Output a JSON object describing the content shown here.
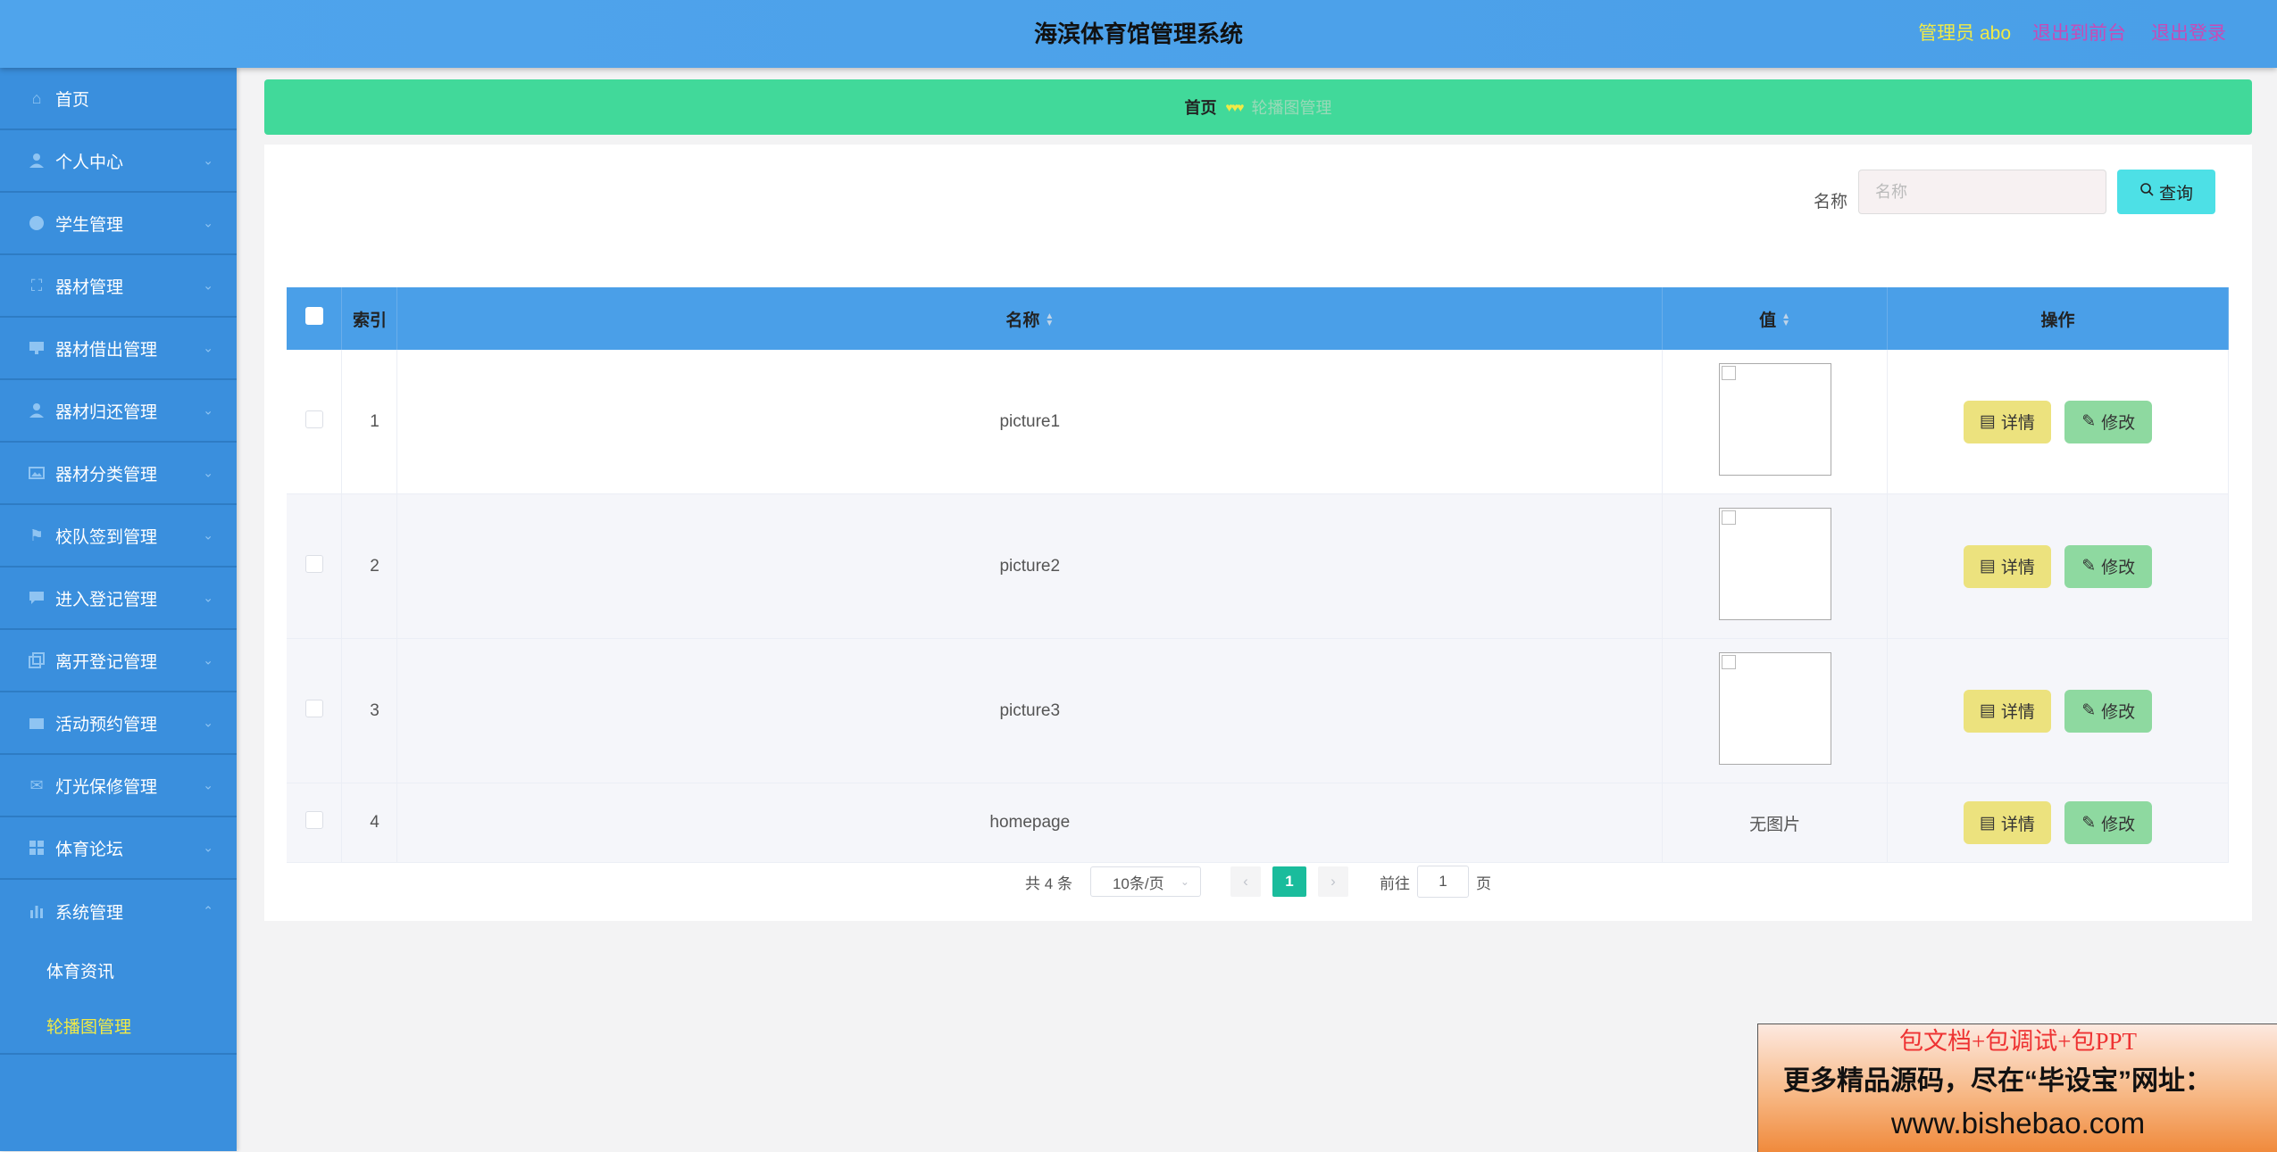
{
  "header": {
    "title": "海滨体育馆管理系统",
    "admin": "管理员 abo",
    "front": "退出到前台",
    "logout": "退出登录"
  },
  "sidebar": {
    "items": [
      {
        "label": "首页",
        "icon": "home-icon"
      },
      {
        "label": "个人中心",
        "icon": "user-icon"
      },
      {
        "label": "学生管理",
        "icon": "palette-icon"
      },
      {
        "label": "器材管理",
        "icon": "fullscreen-icon"
      },
      {
        "label": "器材借出管理",
        "icon": "monitor-icon"
      },
      {
        "label": "器材归还管理",
        "icon": "person-icon"
      },
      {
        "label": "器材分类管理",
        "icon": "picture-icon"
      },
      {
        "label": "校队签到管理",
        "icon": "flag-icon"
      },
      {
        "label": "进入登记管理",
        "icon": "message-icon"
      },
      {
        "label": "离开登记管理",
        "icon": "copy-icon"
      },
      {
        "label": "活动预约管理",
        "icon": "wallet-icon"
      },
      {
        "label": "灯光保修管理",
        "icon": "mail-icon"
      },
      {
        "label": "体育论坛",
        "icon": "grid-icon"
      },
      {
        "label": "系统管理",
        "icon": "bar-chart-icon"
      }
    ],
    "sub_items": [
      {
        "label": "体育资讯"
      },
      {
        "label": "轮播图管理"
      }
    ]
  },
  "breadcrumb": {
    "home": "首页",
    "hearts": "♥♥♥",
    "current": "轮播图管理"
  },
  "search": {
    "label": "名称",
    "placeholder": "名称",
    "button": "查询"
  },
  "table": {
    "headers": {
      "index": "索引",
      "name": "名称",
      "value": "值",
      "action": "操作"
    },
    "rows": [
      {
        "index": "1",
        "name": "picture1",
        "value": ""
      },
      {
        "index": "2",
        "name": "picture2",
        "value": ""
      },
      {
        "index": "3",
        "name": "picture3",
        "value": ""
      },
      {
        "index": "4",
        "name": "homepage",
        "value": "无图片"
      }
    ],
    "detail_label": "详情",
    "edit_label": "修改"
  },
  "pagination": {
    "total": "共 4 条",
    "page_size": "10条/页",
    "current": "1",
    "goto_label": "前往",
    "goto_value": "1",
    "page_suffix": "页"
  },
  "ad": {
    "line1": "包文档+包调试+包PPT",
    "line2": "更多精品源码，尽在“毕设宝”网址：",
    "line3": "www.bishebao.com"
  },
  "colors": {
    "header": "#4fa4ec",
    "sidebar": "#3a8fdd",
    "breadcrumb": "#41d99a",
    "search_button": "#4de0e6",
    "detail_button": "#ece27e",
    "edit_button": "#8ed9a0",
    "page_active": "#1abc9c"
  }
}
